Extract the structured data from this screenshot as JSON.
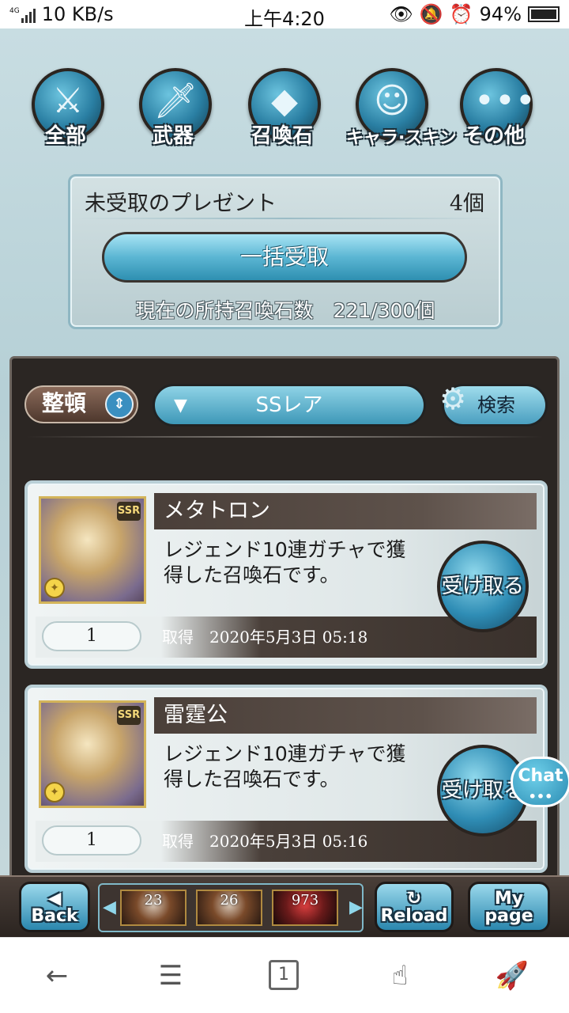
{
  "status": {
    "net_speed": "10 KB/s",
    "net_type": "4G",
    "time": "上午4:20",
    "battery": "94%"
  },
  "categories": [
    {
      "label": "全部",
      "icon": "all-items-icon"
    },
    {
      "label": "武器",
      "icon": "weapon-icon"
    },
    {
      "label": "召喚石",
      "icon": "summon-stone-icon"
    },
    {
      "label": "キャラ·スキン",
      "icon": "character-skin-icon"
    },
    {
      "label": "その他",
      "icon": "more-icon"
    }
  ],
  "present_box": {
    "title": "未受取のプレゼント",
    "count": "4個",
    "bulk_button": "一括受取",
    "stock": "現在の所持召喚石数　221/300個"
  },
  "filters": {
    "sort_label": "整頓",
    "rarity": "SSレア",
    "search_label": "検索"
  },
  "items": [
    {
      "name": "メタトロン",
      "badge": "SSR",
      "desc_line1": "レジェンド10連ガチャで獲",
      "desc_line2": "得した召喚石です。",
      "button": "受け取る",
      "qty": "1",
      "acq_label": "取得",
      "acq_date": "2020年5月3日 05:18"
    },
    {
      "name": "雷霆公",
      "badge": "SSR",
      "desc_line1": "レジェンド10連ガチャで獲",
      "desc_line2": "得した召喚石です。",
      "button": "受け取る",
      "qty": "1",
      "acq_label": "取得",
      "acq_date": "2020年5月3日 05:16"
    }
  ],
  "chat": {
    "label": "Chat",
    "dots": "•••"
  },
  "game_nav": {
    "back_line1": "◀",
    "back_line2": "Back",
    "reload_line1": "↻",
    "reload_line2": "Reload",
    "mypage_line1": "My",
    "mypage_line2": "page",
    "quests": [
      "23",
      "26",
      "973"
    ]
  },
  "browser": {
    "back_icon": "←",
    "menu_icon": "☰",
    "tabs": "1",
    "gesture_icon": "☝",
    "rocket_icon": "🚀"
  },
  "colors": {
    "accent": "#2f8db5",
    "panel_dark": "#2b2623",
    "bg_light": "#c8dde2"
  }
}
